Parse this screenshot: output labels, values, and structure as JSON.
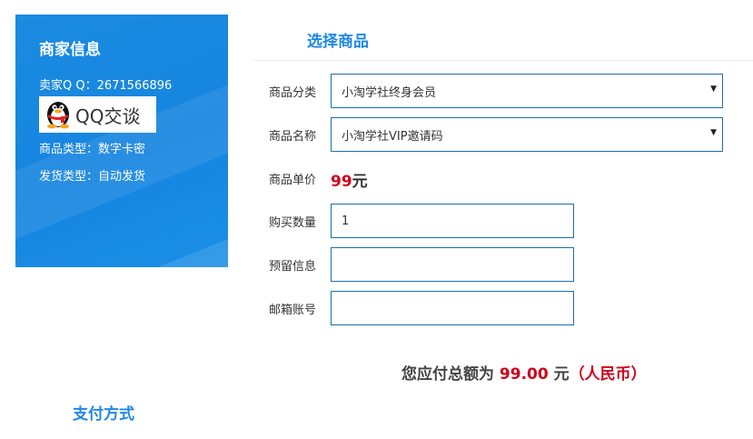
{
  "seller": {
    "title": "商家信息",
    "qq_line": "卖家Q Q：2671566896",
    "qq_button_text": "QQ交谈",
    "product_type_line": "商品类型：数字卡密",
    "delivery_type_line": "发货类型：自动发货"
  },
  "product_section": {
    "title": "选择商品",
    "category": {
      "label": "商品分类",
      "selected": "小淘学社终身会员"
    },
    "name": {
      "label": "商品名称",
      "selected": "小淘学社VIP邀请码"
    },
    "unit_price": {
      "label": "商品单价",
      "value": "99",
      "unit": "元"
    },
    "quantity": {
      "label": "购买数量",
      "value": "1"
    },
    "reserved_info": {
      "label": "预留信息",
      "value": ""
    },
    "email": {
      "label": "邮箱账号",
      "value": ""
    }
  },
  "total": {
    "prefix": "您应付总额为",
    "amount": "99.00",
    "unit": "元",
    "currency": "（人民币）"
  },
  "payment": {
    "title": "支付方式"
  },
  "icons": {
    "qq": "qq-penguin-icon",
    "dropdown": "caret-down-icon"
  },
  "colors": {
    "panel_blue": "#1685e0",
    "accent_blue": "#1e88e5",
    "price_red": "#d0021b",
    "input_border": "#1e6fa8"
  }
}
